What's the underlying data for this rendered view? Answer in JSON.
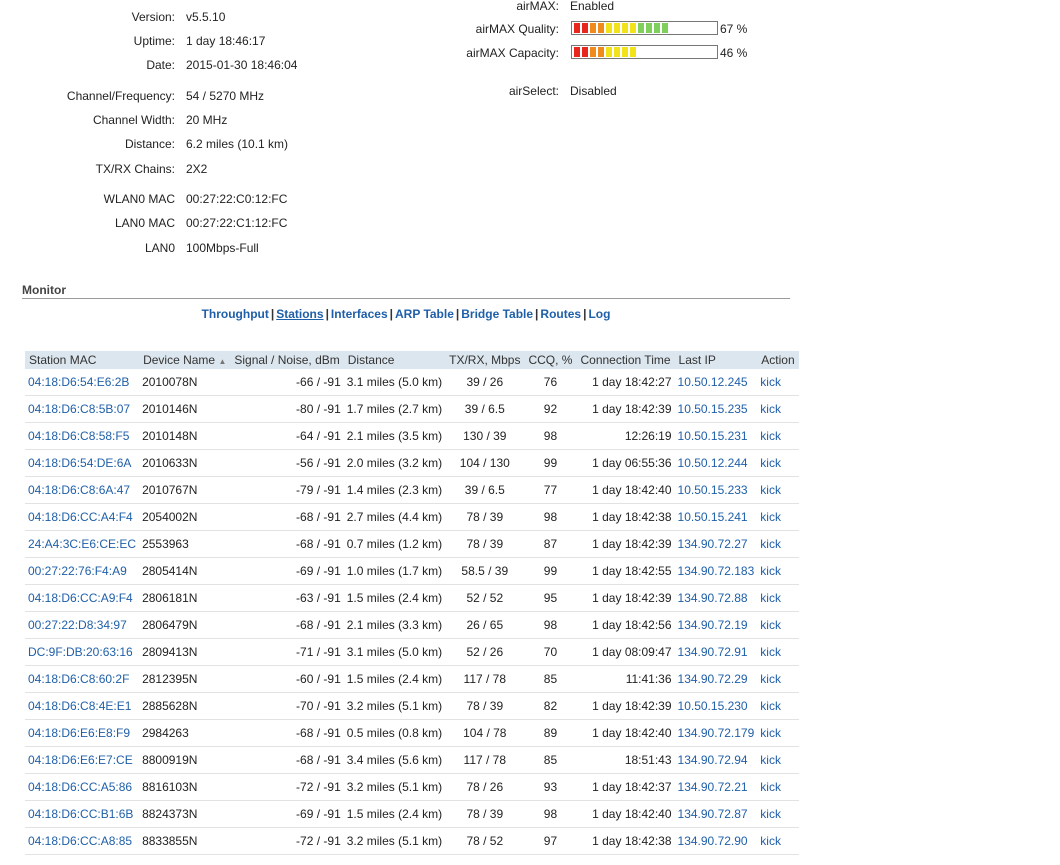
{
  "info_left": [
    {
      "label": "Version:",
      "value": "v5.5.10"
    },
    {
      "label": "Uptime:",
      "value": "1 day 18:46:17"
    },
    {
      "label": "Date:",
      "value": "2015-01-30 18:46:04"
    },
    {
      "label": "Channel/Frequency:",
      "value": "54 / 5270 MHz"
    },
    {
      "label": "Channel Width:",
      "value": "20 MHz"
    },
    {
      "label": "Distance:",
      "value": "6.2 miles (10.1 km)"
    },
    {
      "label": "TX/RX Chains:",
      "value": "2X2"
    },
    {
      "label": "WLAN0 MAC",
      "value": "00:27:22:C0:12:FC"
    },
    {
      "label": "LAN0 MAC",
      "value": "00:27:22:C1:12:FC"
    },
    {
      "label": "LAN0",
      "value": "100Mbps-Full"
    }
  ],
  "info_right": {
    "airmax": {
      "label": "airMAX:",
      "value": "Enabled"
    },
    "quality": {
      "label": "airMAX Quality:",
      "value": "67 %",
      "level": 0.67
    },
    "capacity": {
      "label": "airMAX Capacity:",
      "value": "46 %",
      "level": 0.46
    },
    "airselect": {
      "label": "airSelect:",
      "value": "Disabled"
    }
  },
  "monitor": {
    "title": "Monitor",
    "tabs": [
      "Throughput",
      "Stations",
      "Interfaces",
      "ARP Table",
      "Bridge Table",
      "Routes",
      "Log"
    ],
    "active_tab": "Stations",
    "sort_icon": "sort-ascending-icon"
  },
  "table": {
    "headers": [
      "Station MAC",
      "Device Name",
      "Signal / Noise, dBm",
      "Distance",
      "TX/RX, Mbps",
      "CCQ, %",
      "Connection Time",
      "Last IP",
      "Action"
    ],
    "rows": [
      [
        "04:18:D6:54:E6:2B",
        "2010078N",
        "-66 / -91",
        "3.1 miles (5.0 km)",
        "39 / 26",
        "76",
        "1 day 18:42:27",
        "10.50.12.245",
        "kick"
      ],
      [
        "04:18:D6:C8:5B:07",
        "2010146N",
        "-80 / -91",
        "1.7 miles (2.7 km)",
        "39 / 6.5",
        "92",
        "1 day 18:42:39",
        "10.50.15.235",
        "kick"
      ],
      [
        "04:18:D6:C8:58:F5",
        "2010148N",
        "-64 / -91",
        "2.1 miles (3.5 km)",
        "130 / 39",
        "98",
        "12:26:19",
        "10.50.15.231",
        "kick"
      ],
      [
        "04:18:D6:54:DE:6A",
        "2010633N",
        "-56 / -91",
        "2.0 miles (3.2 km)",
        "104 / 130",
        "99",
        "1 day 06:55:36",
        "10.50.12.244",
        "kick"
      ],
      [
        "04:18:D6:C8:6A:47",
        "2010767N",
        "-79 / -91",
        "1.4 miles (2.3 km)",
        "39 / 6.5",
        "77",
        "1 day 18:42:40",
        "10.50.15.233",
        "kick"
      ],
      [
        "04:18:D6:CC:A4:F4",
        "2054002N",
        "-68 / -91",
        "2.7 miles (4.4 km)",
        "78 / 39",
        "98",
        "1 day 18:42:38",
        "10.50.15.241",
        "kick"
      ],
      [
        "24:A4:3C:E6:CE:EC",
        "2553963",
        "-68 / -91",
        "0.7 miles (1.2 km)",
        "78 / 39",
        "87",
        "1 day 18:42:39",
        "134.90.72.27",
        "kick"
      ],
      [
        "00:27:22:76:F4:A9",
        "2805414N",
        "-69 / -91",
        "1.0 miles (1.7 km)",
        "58.5 / 39",
        "99",
        "1 day 18:42:55",
        "134.90.72.183",
        "kick"
      ],
      [
        "04:18:D6:CC:A9:F4",
        "2806181N",
        "-63 / -91",
        "1.5 miles (2.4 km)",
        "52 / 52",
        "95",
        "1 day 18:42:39",
        "134.90.72.88",
        "kick"
      ],
      [
        "00:27:22:D8:34:97",
        "2806479N",
        "-68 / -91",
        "2.1 miles (3.3 km)",
        "26 / 65",
        "98",
        "1 day 18:42:56",
        "134.90.72.19",
        "kick"
      ],
      [
        "DC:9F:DB:20:63:16",
        "2809413N",
        "-71 / -91",
        "3.1 miles (5.0 km)",
        "52 / 26",
        "70",
        "1 day 08:09:47",
        "134.90.72.91",
        "kick"
      ],
      [
        "04:18:D6:C8:60:2F",
        "2812395N",
        "-60 / -91",
        "1.5 miles (2.4 km)",
        "117 / 78",
        "85",
        "11:41:36",
        "134.90.72.29",
        "kick"
      ],
      [
        "04:18:D6:C8:4E:E1",
        "2885628N",
        "-70 / -91",
        "3.2 miles (5.1 km)",
        "78 / 39",
        "82",
        "1 day 18:42:39",
        "10.50.15.230",
        "kick"
      ],
      [
        "04:18:D6:E6:E8:F9",
        "2984263",
        "-68 / -91",
        "0.5 miles (0.8 km)",
        "104 / 78",
        "89",
        "1 day 18:42:40",
        "134.90.72.179",
        "kick"
      ],
      [
        "04:18:D6:E6:E7:CE",
        "8800919N",
        "-68 / -91",
        "3.4 miles (5.6 km)",
        "117 / 78",
        "85",
        "18:51:43",
        "134.90.72.94",
        "kick"
      ],
      [
        "04:18:D6:CC:A5:86",
        "8816103N",
        "-72 / -91",
        "3.2 miles (5.1 km)",
        "78 / 26",
        "93",
        "1 day 18:42:37",
        "134.90.72.21",
        "kick"
      ],
      [
        "04:18:D6:CC:B1:6B",
        "8824373N",
        "-69 / -91",
        "1.5 miles (2.4 km)",
        "78 / 39",
        "98",
        "1 day 18:42:40",
        "134.90.72.87",
        "kick"
      ],
      [
        "04:18:D6:CC:A8:85",
        "8833855N",
        "-72 / -91",
        "3.2 miles (5.1 km)",
        "78 / 52",
        "97",
        "1 day 18:42:38",
        "134.90.72.90",
        "kick"
      ]
    ]
  },
  "colors": {
    "link": "#1f5fa8",
    "header_bg": "#dce6ee",
    "bar_red": "#e8261d",
    "bar_orange": "#f08a1c",
    "bar_yellow": "#f2e21a",
    "bar_green": "#7fd05a"
  }
}
